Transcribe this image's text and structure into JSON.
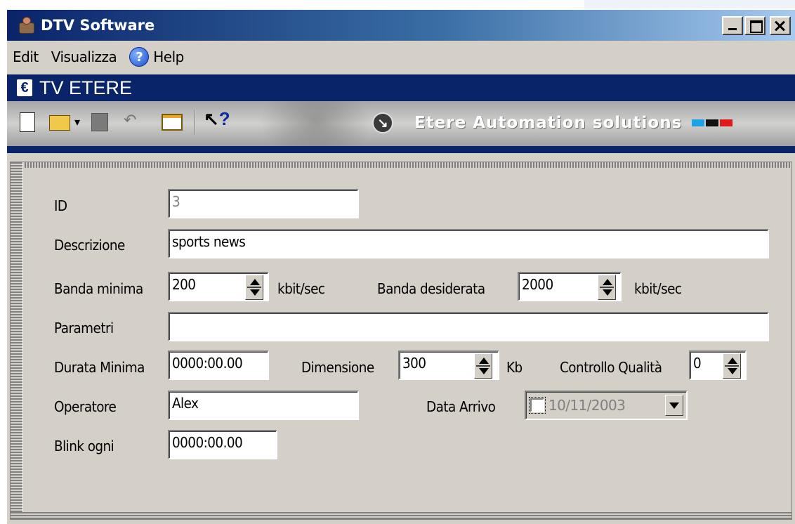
{
  "window": {
    "title": "DTV Software"
  },
  "menu": {
    "items": [
      "Edit",
      "Visualizza",
      "Help"
    ]
  },
  "banner": {
    "title": "TV ETERE"
  },
  "toolbar": {
    "logo_text": "Etere Automation solutions",
    "logo_bar_colors": [
      "#1aa3e6",
      "#111111",
      "#e0191b"
    ]
  },
  "form": {
    "id_label": "ID",
    "id_value": "3",
    "descrizione_label": "Descrizione",
    "descrizione_value": "sports news",
    "banda_minima_label": "Banda minima",
    "banda_minima_value": "200",
    "banda_minima_unit": "kbit/sec",
    "banda_desiderata_label": "Banda desiderata",
    "banda_desiderata_value": "2000",
    "banda_desiderata_unit": "kbit/sec",
    "parametri_label": "Parametri",
    "parametri_value": "",
    "durata_minima_label": "Durata Minima",
    "durata_minima_value": "0000:00.00",
    "dimensione_label": "Dimensione",
    "dimensione_value": "300",
    "dimensione_unit": "Kb",
    "controllo_qualita_label": "Controllo Qualità",
    "controllo_qualita_value": "0",
    "operatore_label": "Operatore",
    "operatore_value": "Alex",
    "data_arrivo_label": "Data Arrivo",
    "data_arrivo_value": "10/11/2003",
    "data_arrivo_checked": false,
    "blink_ogni_label": "Blink ogni",
    "blink_ogni_value": "0000:00.00"
  }
}
